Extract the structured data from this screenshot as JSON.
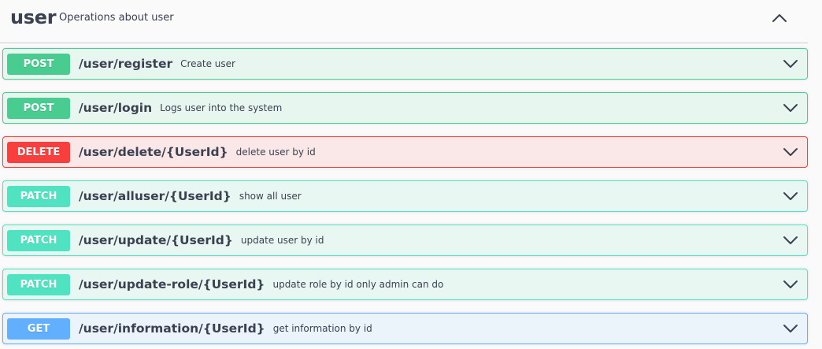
{
  "tag": {
    "name": "user",
    "description": "Operations about user"
  },
  "operations": [
    {
      "method": "POST",
      "path": "/user/register",
      "summary": "Create user"
    },
    {
      "method": "POST",
      "path": "/user/login",
      "summary": "Logs user into the system"
    },
    {
      "method": "DELETE",
      "path": "/user/delete/{UserId}",
      "summary": "delete user by id"
    },
    {
      "method": "PATCH",
      "path": "/user/alluser/{UserId}",
      "summary": "show all user"
    },
    {
      "method": "PATCH",
      "path": "/user/update/{UserId}",
      "summary": "update user by id"
    },
    {
      "method": "PATCH",
      "path": "/user/update-role/{UserId}",
      "summary": "update role by id only admin can do"
    },
    {
      "method": "GET",
      "path": "/user/information/{UserId}",
      "summary": "get information by id"
    }
  ],
  "colors": {
    "post": "#49cc90",
    "delete": "#f93e3e",
    "patch": "#50e3c2",
    "get": "#61affe",
    "text": "#3b4151"
  },
  "icons": {
    "collapse": "chevron-up-icon",
    "expand": "chevron-down-icon"
  }
}
